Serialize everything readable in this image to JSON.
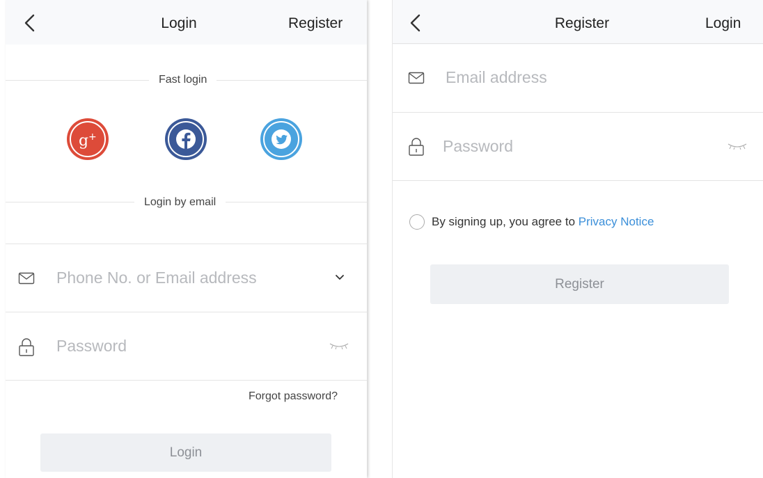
{
  "login_screen": {
    "title": "Login",
    "nav_right": "Register",
    "fast_login_label": "Fast login",
    "social": [
      "google-plus-icon",
      "facebook-icon",
      "twitter-icon"
    ],
    "login_by_email_label": "Login by email",
    "email_placeholder": "Phone No. or Email address",
    "password_placeholder": "Password",
    "forgot_password": "Forgot password?",
    "login_button": "Login"
  },
  "register_screen": {
    "title": "Register",
    "nav_right": "Login",
    "email_placeholder": "Email address",
    "password_placeholder": "Password",
    "agree_text": "By signing up, you agree to",
    "privacy_link": "Privacy Notice",
    "register_button": "Register"
  },
  "colors": {
    "google": "#dd4b39",
    "facebook": "#3b5998",
    "twitter": "#1da1f2",
    "link": "#3b8fd9",
    "button_bg": "#eef0f3"
  }
}
